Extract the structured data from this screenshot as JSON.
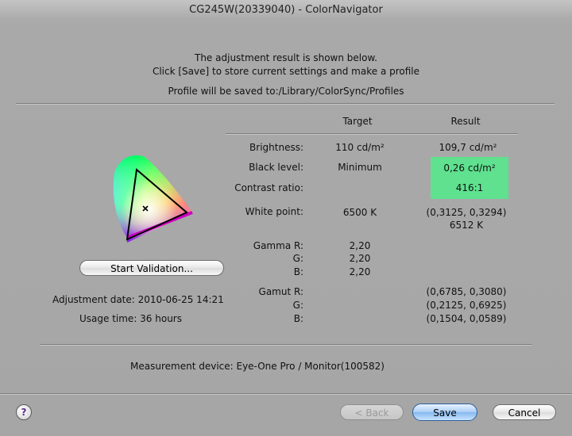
{
  "window": {
    "title": "CG245W(20339040) - ColorNavigator"
  },
  "header": {
    "line1": "The adjustment result is shown below.",
    "line2": "Click [Save] to store current settings and make a profile",
    "line3": "Profile will be saved to:/Library/ColorSync/Profiles"
  },
  "columns": {
    "target": "Target",
    "result": "Result"
  },
  "rows": {
    "brightness": {
      "label": "Brightness:",
      "target": "110 cd/m²",
      "result": "109,7 cd/m²"
    },
    "black_level": {
      "label": "Black level:",
      "target": "Minimum",
      "result": "0,26 cd/m²"
    },
    "contrast": {
      "label": "Contrast ratio:",
      "target": "",
      "result": "416:1"
    },
    "white_point": {
      "label": "White point:",
      "target": "6500 K",
      "result": "(0,3125, 0,3294)",
      "result2": "6512 K"
    },
    "gamma_r": {
      "label": "Gamma R:",
      "target": "2,20"
    },
    "gamma_g": {
      "label": "G:",
      "target": "2,20"
    },
    "gamma_b": {
      "label": "B:",
      "target": "2,20"
    },
    "gamut_r": {
      "label": "Gamut R:",
      "result": "(0,6785, 0,3080)"
    },
    "gamut_g": {
      "label": "G:",
      "result": "(0,2125, 0,6925)"
    },
    "gamut_b": {
      "label": "B:",
      "result": "(0,1504, 0,0589)"
    }
  },
  "left": {
    "validation_button": "Start Validation...",
    "adjustment_date": "Adjustment date: 2010-06-25 14:21",
    "usage_time": "Usage time: 36 hours"
  },
  "measurement": "Measurement device:  Eye-One Pro / Monitor(100582)",
  "buttons": {
    "help": "?",
    "back": "< Back",
    "save": "Save",
    "cancel": "Cancel"
  },
  "colors": {
    "highlight": "#5fe18f",
    "default_button": "#86b8ef"
  },
  "icons": {
    "gamut_chart": "cie-chromaticity-diagram",
    "help": "help-icon"
  }
}
